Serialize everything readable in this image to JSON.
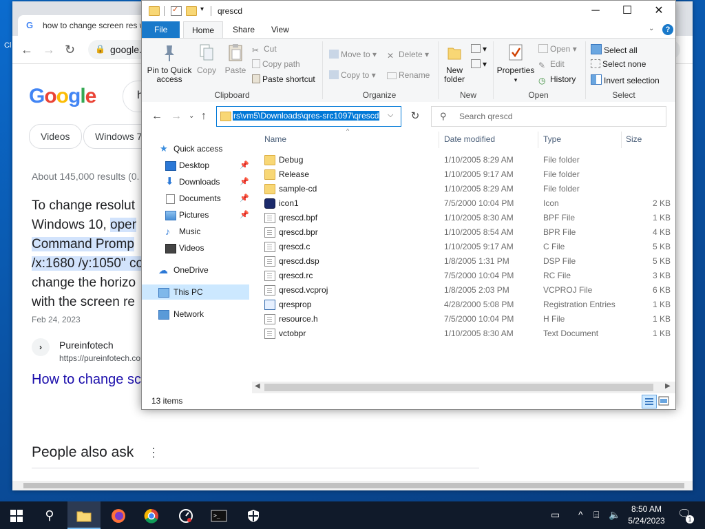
{
  "browser": {
    "tab_title": "how to change screen res w",
    "url": "google.",
    "search_query": "h",
    "chips": [
      "Videos",
      "Windows 7"
    ],
    "stats": "About 145,000 results (0.",
    "snippet_lines": [
      {
        "pre": "To change resolut",
        "hl": ""
      },
      {
        "pre": "Windows 10, ",
        "hl": "oper"
      },
      {
        "pre": "",
        "hl": "Command Promp"
      },
      {
        "pre": "",
        "hl": "/x:1680 /y:1050\" co"
      },
      {
        "pre": "change the horizo",
        "hl": ""
      },
      {
        "pre": "with the screen re",
        "hl": ""
      }
    ],
    "date": "Feb 24, 2023",
    "site_name": "Pureinfotech",
    "site_url": "https://pureinfotech.co",
    "result_link": "How to change sc",
    "people_also_ask": "People also ask"
  },
  "explorer": {
    "title": "qrescd",
    "tabs": {
      "file": "File",
      "home": "Home",
      "share": "Share",
      "view": "View"
    },
    "ribbon": {
      "clipboard": {
        "label": "Clipboard",
        "pin": "Pin to Quick access",
        "copy": "Copy",
        "paste": "Paste",
        "cut": "Cut",
        "copy_path": "Copy path",
        "paste_shortcut": "Paste shortcut"
      },
      "organize": {
        "label": "Organize",
        "move_to": "Move to",
        "copy_to": "Copy to",
        "delete": "Delete",
        "rename": "Rename"
      },
      "new": {
        "label": "New",
        "new_folder": "New folder"
      },
      "open": {
        "label": "Open",
        "properties": "Properties",
        "open": "Open",
        "edit": "Edit",
        "history": "History"
      },
      "select": {
        "label": "Select",
        "select_all": "Select all",
        "select_none": "Select none",
        "invert": "Invert selection"
      }
    },
    "address": "rs\\vm5\\Downloads\\qres-src1097\\qrescd",
    "search_placeholder": "Search qrescd",
    "nav": {
      "quick_access": "Quick access",
      "desktop": "Desktop",
      "downloads": "Downloads",
      "documents": "Documents",
      "pictures": "Pictures",
      "music": "Music",
      "videos": "Videos",
      "onedrive": "OneDrive",
      "this_pc": "This PC",
      "network": "Network"
    },
    "columns": {
      "name": "Name",
      "date": "Date modified",
      "type": "Type",
      "size": "Size"
    },
    "files": [
      {
        "name": "Debug",
        "date": "1/10/2005 8:29 AM",
        "type": "File folder",
        "size": "",
        "icon": "folder"
      },
      {
        "name": "Release",
        "date": "1/10/2005 9:17 AM",
        "type": "File folder",
        "size": "",
        "icon": "folder"
      },
      {
        "name": "sample-cd",
        "date": "1/10/2005 8:29 AM",
        "type": "File folder",
        "size": "",
        "icon": "folder"
      },
      {
        "name": "icon1",
        "date": "7/5/2000 10:04 PM",
        "type": "Icon",
        "size": "2 KB",
        "icon": "iconfile"
      },
      {
        "name": "qrescd.bpf",
        "date": "1/10/2005 8:30 AM",
        "type": "BPF File",
        "size": "1 KB",
        "icon": "file"
      },
      {
        "name": "qrescd.bpr",
        "date": "1/10/2005 8:54 AM",
        "type": "BPR File",
        "size": "4 KB",
        "icon": "file"
      },
      {
        "name": "qrescd.c",
        "date": "1/10/2005 9:17 AM",
        "type": "C File",
        "size": "5 KB",
        "icon": "file"
      },
      {
        "name": "qrescd.dsp",
        "date": "1/8/2005 1:31 PM",
        "type": "DSP File",
        "size": "5 KB",
        "icon": "file"
      },
      {
        "name": "qrescd.rc",
        "date": "7/5/2000 10:04 PM",
        "type": "RC File",
        "size": "3 KB",
        "icon": "file"
      },
      {
        "name": "qrescd.vcproj",
        "date": "1/8/2005 2:03 PM",
        "type": "VCPROJ File",
        "size": "6 KB",
        "icon": "file"
      },
      {
        "name": "qresprop",
        "date": "4/28/2000 5:08 PM",
        "type": "Registration Entries",
        "size": "1 KB",
        "icon": "reg"
      },
      {
        "name": "resource.h",
        "date": "7/5/2000 10:04 PM",
        "type": "H File",
        "size": "1 KB",
        "icon": "file"
      },
      {
        "name": "vctobpr",
        "date": "1/10/2005 8:30 AM",
        "type": "Text Document",
        "size": "1 KB",
        "icon": "file"
      }
    ],
    "status": "13 items"
  },
  "taskbar": {
    "time": "8:50 AM",
    "date": "5/24/2023",
    "notification_count": "1"
  },
  "colors": {
    "accent": "#0078d7",
    "file_tab": "#1979ca",
    "selection": "#cce8ff",
    "taskbar": "#101a2a"
  }
}
